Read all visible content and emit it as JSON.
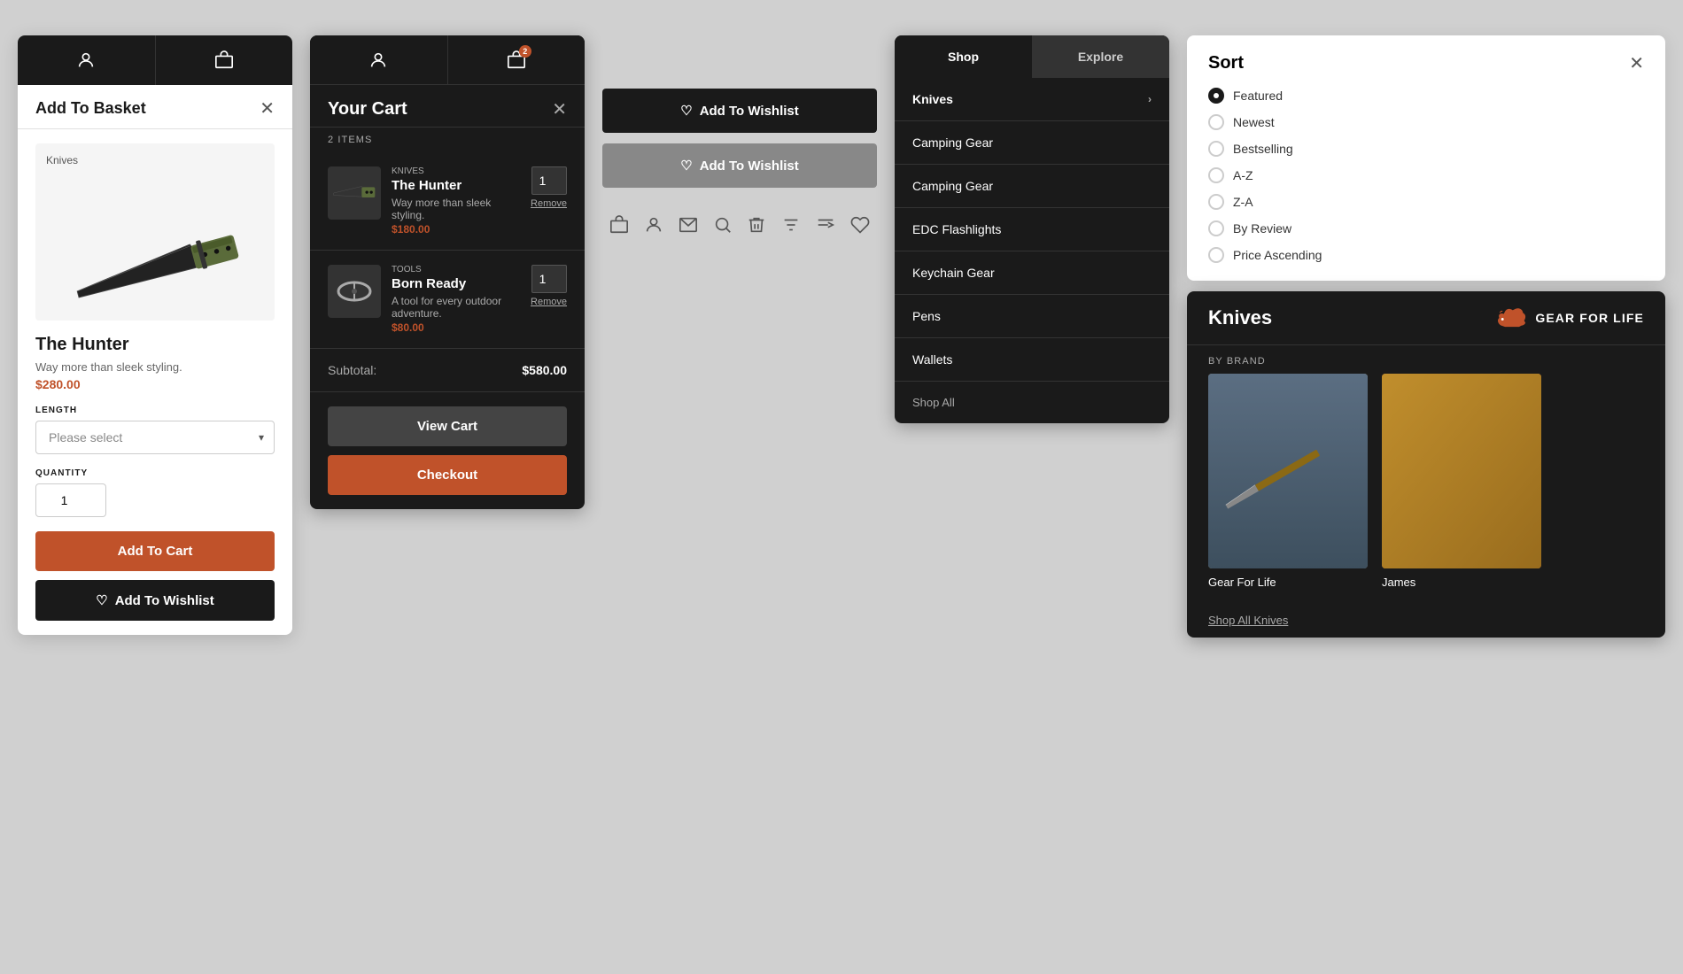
{
  "panels": {
    "basket": {
      "title": "Add To Basket",
      "category": "Knives",
      "product_name": "The Hunter",
      "product_desc": "Way more than sleek styling.",
      "product_price": "$280.00",
      "length_label": "LENGTH",
      "length_placeholder": "Please select",
      "quantity_label": "QUANTITY",
      "quantity_value": "1",
      "add_to_cart_label": "Add To Cart",
      "wishlist_label": "Add To Wishlist"
    },
    "cart": {
      "title": "Your Cart",
      "items_count": "2 ITEMS",
      "items": [
        {
          "category": "Knives",
          "name": "The Hunter",
          "desc": "Way more than sleek styling.",
          "price": "$180.00",
          "qty": "1",
          "remove_label": "Remove"
        },
        {
          "category": "Tools",
          "name": "Born Ready",
          "desc": "A tool for every outdoor adventure.",
          "price": "$80.00",
          "qty": "1",
          "remove_label": "Remove"
        }
      ],
      "subtotal_label": "Subtotal:",
      "subtotal_amount": "$580.00",
      "view_cart_label": "View Cart",
      "checkout_label": "Checkout"
    },
    "wishlist_buttons": {
      "btn1_label": "Add To Wishlist",
      "btn2_label": "Add To Wishlist"
    },
    "shop_nav": {
      "tab_shop": "Shop",
      "tab_explore": "Explore",
      "items": [
        {
          "label": "Knives",
          "active": true
        },
        {
          "label": "Camping Gear",
          "active": false
        },
        {
          "label": "Camping Gear",
          "active": false
        },
        {
          "label": "EDC Flashlights",
          "active": false
        },
        {
          "label": "Keychain Gear",
          "active": false
        },
        {
          "label": "Pens",
          "active": false
        },
        {
          "label": "Wallets",
          "active": false
        }
      ],
      "shop_all_label": "Shop All"
    },
    "sort": {
      "title": "Sort",
      "options": [
        {
          "label": "Featured",
          "selected": true
        },
        {
          "label": "Newest",
          "selected": false
        },
        {
          "label": "Bestselling",
          "selected": false
        },
        {
          "label": "A-Z",
          "selected": false
        },
        {
          "label": "Z-A",
          "selected": false
        },
        {
          "label": "By Review",
          "selected": false
        },
        {
          "label": "Price Ascending",
          "selected": false
        }
      ]
    },
    "product_section": {
      "title": "Knives",
      "brand_name": "GEAR FOR LIFE",
      "by_brand_label": "BY BRAND",
      "products": [
        {
          "name": "Gear For Life",
          "color": "brown"
        },
        {
          "name": "James",
          "color": "orange"
        }
      ],
      "shop_all_label": "Shop All Knives"
    }
  }
}
